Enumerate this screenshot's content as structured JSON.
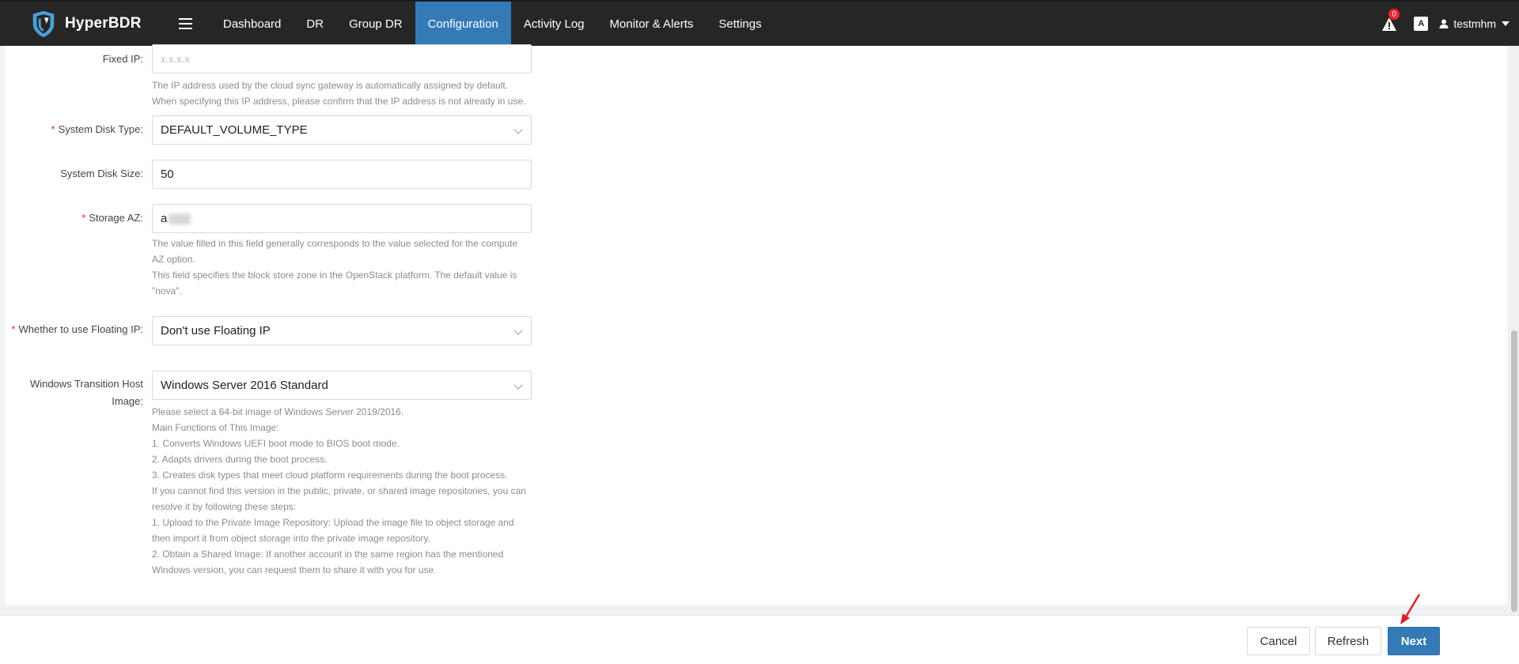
{
  "app": {
    "name": "HyperBDR"
  },
  "nav": {
    "items": [
      {
        "label": "Dashboard",
        "active": false
      },
      {
        "label": "DR",
        "active": false
      },
      {
        "label": "Group DR",
        "active": false
      },
      {
        "label": "Configuration",
        "active": true
      },
      {
        "label": "Activity Log",
        "active": false
      },
      {
        "label": "Monitor & Alerts",
        "active": false
      },
      {
        "label": "Settings",
        "active": false
      }
    ],
    "alert_count": "0",
    "lang_icon_text": "A",
    "username": "testmhm"
  },
  "form": {
    "fixed_ip": {
      "label": "Fixed IP:",
      "placeholder": "x.x.x.x",
      "help": "The IP address used by the cloud sync gateway is automatically assigned by default. When specifying this IP address, please confirm that the IP address is not already in use."
    },
    "system_disk_type": {
      "label": "System Disk Type:",
      "required": true,
      "value": "DEFAULT_VOLUME_TYPE"
    },
    "system_disk_size": {
      "label": "System Disk Size:",
      "value": "50"
    },
    "storage_az": {
      "label": "Storage AZ:",
      "required": true,
      "value_visible_prefix": "a",
      "help_lines": [
        "The value filled in this field generally corresponds to the value selected for the compute AZ option.",
        "This field specifies the block store zone in the OpenStack platform. The default value is \"nova\"."
      ]
    },
    "floating_ip": {
      "label": "Whether to use Floating IP:",
      "required": true,
      "value": "Don't use Floating IP"
    },
    "windows_image": {
      "label": "Windows Transition Host Image:",
      "value": "Windows Server 2016 Standard",
      "help_lines": [
        "Please select a 64-bit image of Windows Server 2019/2016.",
        "Main Functions of This Image:",
        "1. Converts Windows UEFI boot mode to BIOS boot mode.",
        "2. Adapts drivers during the boot process.",
        "3. Creates disk types that meet cloud platform requirements during the boot process.",
        "If you cannot find this version in the public, private, or shared image repositories, you can resolve it by following these steps:",
        "1. Upload to the Private Image Repository: Upload the image file to object storage and then import it from object storage into the private image repository.",
        "2. Obtain a Shared Image: If another account in the same region has the mentioned Windows version, you can request them to share it with you for use."
      ]
    }
  },
  "footer": {
    "cancel_label": "Cancel",
    "refresh_label": "Refresh",
    "next_label": "Next"
  },
  "colors": {
    "topbar": "#262626",
    "active_nav": "#337ab7",
    "primary_button": "#337ab7",
    "required_star": "#f5222d",
    "annotation_arrow": "#e02020"
  }
}
